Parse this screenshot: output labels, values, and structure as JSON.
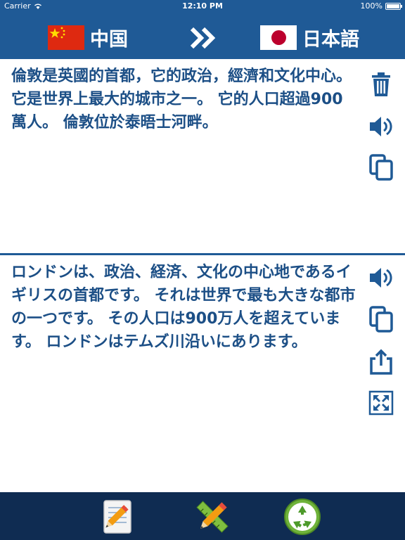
{
  "status_bar": {
    "carrier": "Carrier",
    "time": "12:10 PM",
    "battery": "100%"
  },
  "languages": {
    "source": {
      "name": "中国",
      "flag": "china-flag"
    },
    "target": {
      "name": "日本語",
      "flag": "japan-flag"
    }
  },
  "source_pane": {
    "text": "倫敦是英國的首都，它的政治，經濟和文化中心。 它是世界上最大的城市之一。 它的人口超過900萬人。 倫敦位於泰晤士河畔。"
  },
  "target_pane": {
    "text": "ロンドンは、政治、経済、文化の中心地であるイギリスの首都です。 それは世界で最も大きな都市の一つです。 その人口は900万人を超えています。 ロンドンはテムズ川沿いにあります。"
  },
  "icons": {
    "swap": "double-chevron-right-icon",
    "delete": "trash-icon",
    "speak": "speaker-icon",
    "copy": "copy-icon",
    "share": "share-icon",
    "fullscreen": "expand-icon",
    "notes": "notepad-pencil-icon",
    "tools": "ruler-pencil-icon",
    "recycle": "recycle-icon"
  },
  "colors": {
    "header": "#1f5a96",
    "text": "#1c4f86",
    "bottom_bar": "#0f2c52"
  }
}
